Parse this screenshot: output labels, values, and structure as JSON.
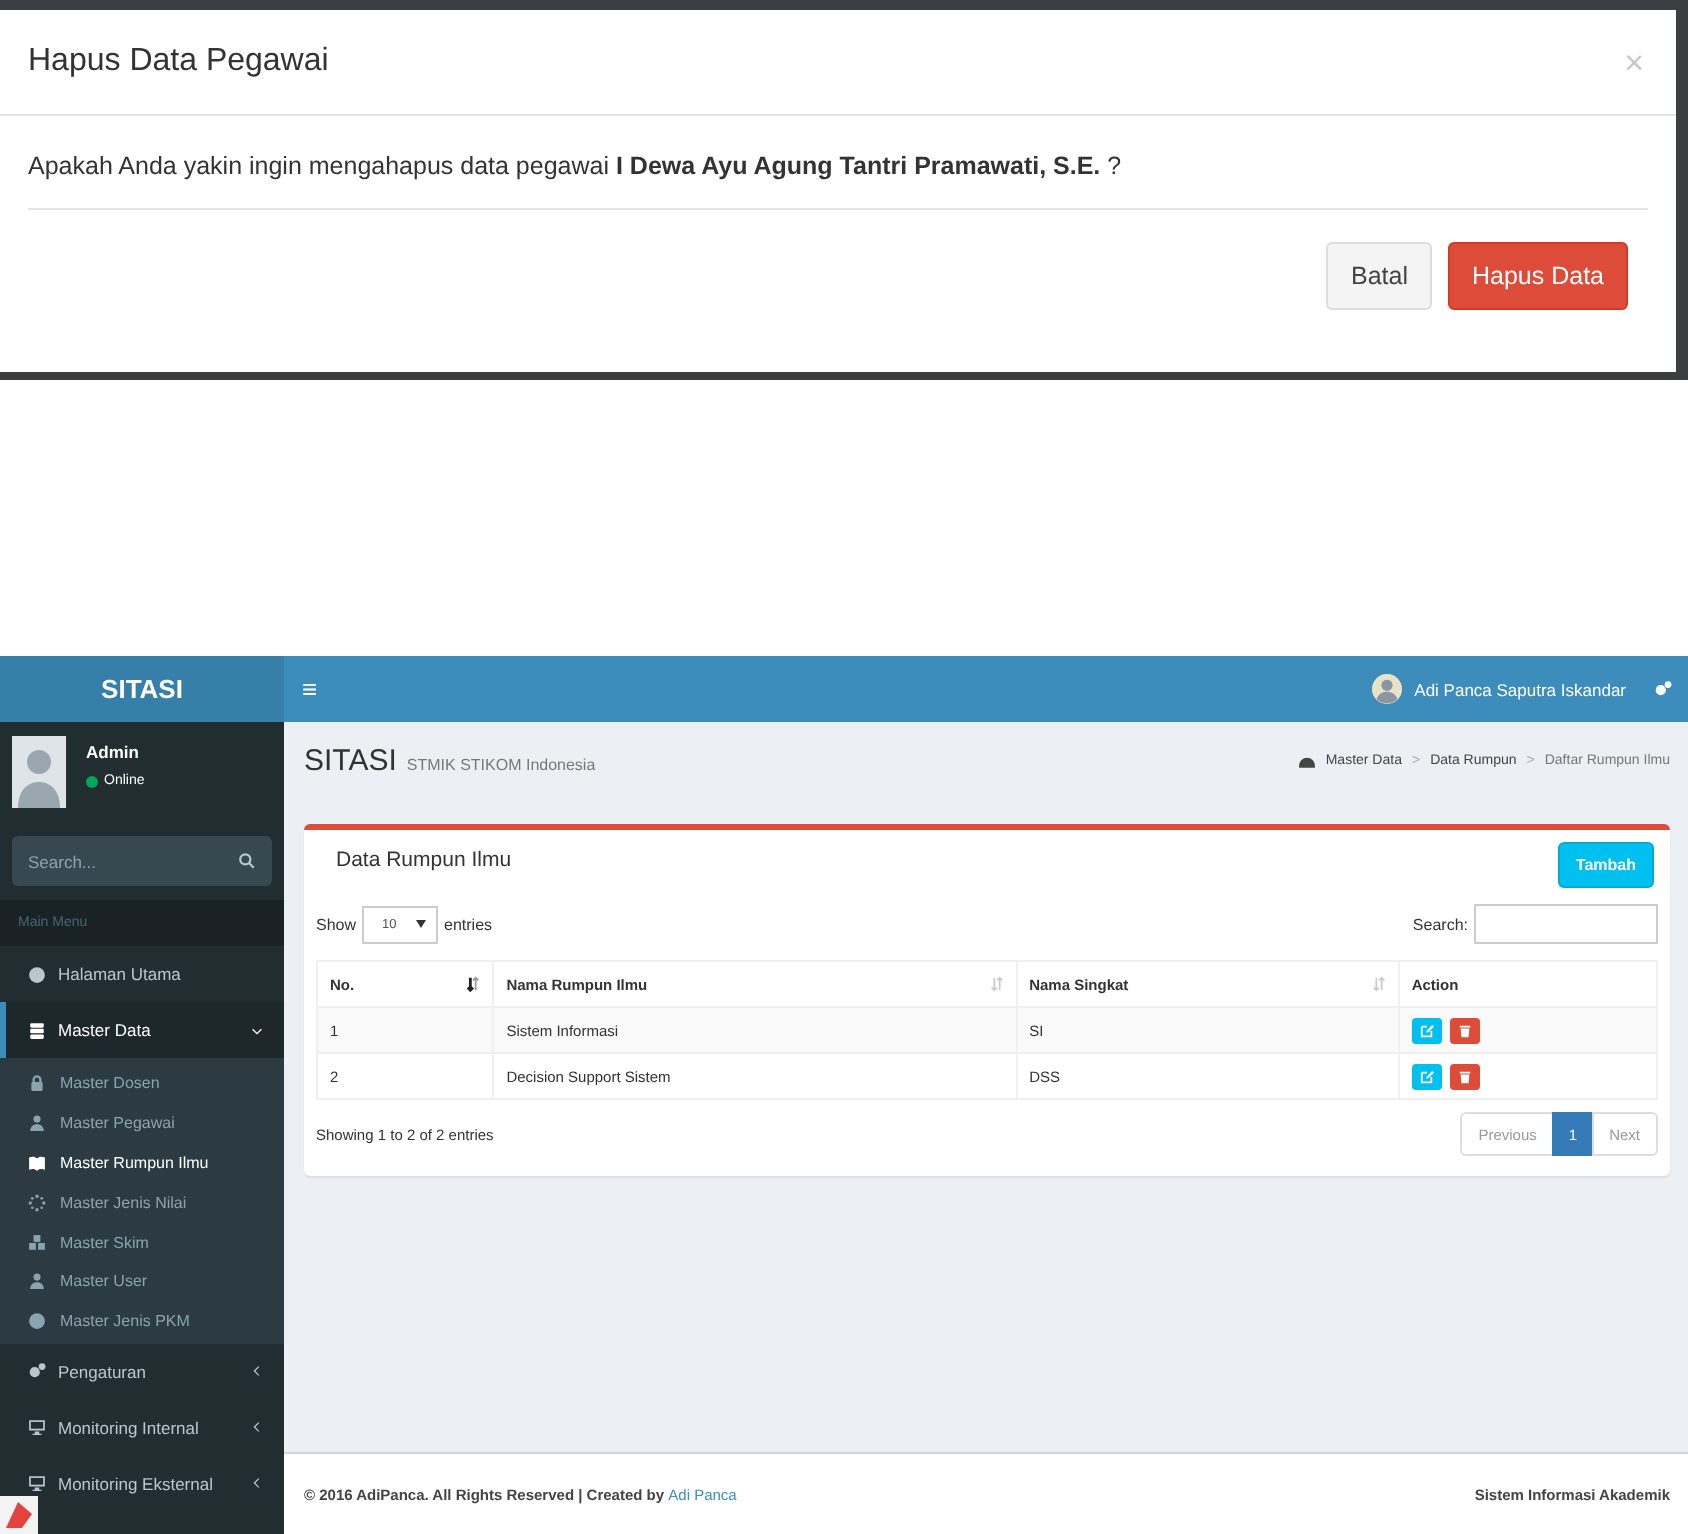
{
  "modal": {
    "title": "Hapus Data Pegawai",
    "close": "×",
    "message": "Apakah Anda yakin ingin mengahapus data pegawai **I Dewa Ayu Agung Tantri Pramawati, S.E.** ?",
    "buttons": [
      {
        "label": "Batal",
        "kind": "default"
      },
      {
        "label": "Hapus Data",
        "kind": "danger"
      }
    ]
  },
  "app": {
    "brand": "SITASI",
    "user": {
      "name": "Admin",
      "status": "Online"
    },
    "search": {
      "placeholder": "Search..."
    },
    "menu_header": "Main Menu",
    "menu": [
      {
        "label": "Halaman Utama",
        "selected": false
      },
      {
        "label": "Master Data",
        "selected": true,
        "expanded": true,
        "children": [
          {
            "label": "Master Dosen",
            "selected": false
          },
          {
            "label": "Master Pegawai",
            "selected": false
          },
          {
            "label": "Master Rumpun Ilmu",
            "selected": true
          },
          {
            "label": "Master Jenis Nilai",
            "selected": false
          },
          {
            "label": "Master Skim",
            "selected": false
          },
          {
            "label": "Master User",
            "selected": false
          },
          {
            "label": "Master Jenis PKM",
            "selected": false
          }
        ]
      },
      {
        "label": "Pengaturan",
        "selected": false,
        "expanded": false
      },
      {
        "label": "Monitoring Internal",
        "selected": false,
        "expanded": false
      },
      {
        "label": "Monitoring Eksternal",
        "selected": false,
        "expanded": false
      }
    ],
    "topbar": {
      "menu_toggle": "≡",
      "user_name": "Adi Panca Saputra Iskandar"
    },
    "page": {
      "title": "SITASI",
      "subtitle": "STMIK STIKOM Indonesia",
      "breadcrumb": [
        "Master Data",
        "Data Rumpun",
        "Daftar Rumpun Ilmu"
      ],
      "breadcrumb_separator": ">"
    },
    "box": {
      "title": "Data Rumpun Ilmu",
      "add_button": "Tambah",
      "length_prefix": "Show",
      "page_length": "10",
      "length_suffix": "entries",
      "search_label": "Search:",
      "columns": [
        {
          "label": "No.",
          "sortable": true,
          "sorted": true
        },
        {
          "label": "Nama Rumpun Ilmu",
          "sortable": true,
          "sorted": false
        },
        {
          "label": "Nama Singkat",
          "sortable": true,
          "sorted": false
        },
        {
          "label": "Action",
          "sortable": false
        }
      ],
      "rows": [
        [
          "1",
          "Sistem Informasi",
          "SI"
        ],
        [
          "2",
          "Decision Support Sistem",
          "DSS"
        ]
      ],
      "info": "Showing 1 to 2 of 2 entries",
      "pagination": [
        {
          "label": "Previous",
          "selected": false,
          "disabled": true
        },
        {
          "label": "1",
          "selected": true,
          "disabled": false
        },
        {
          "label": "Next",
          "selected": false,
          "disabled": true
        }
      ]
    },
    "footer": {
      "left": "© 2016 AdiPanca. All Rights Reserved | Created by ",
      "link": "Adi Panca",
      "right": "Sistem Informasi Akademik"
    }
  }
}
